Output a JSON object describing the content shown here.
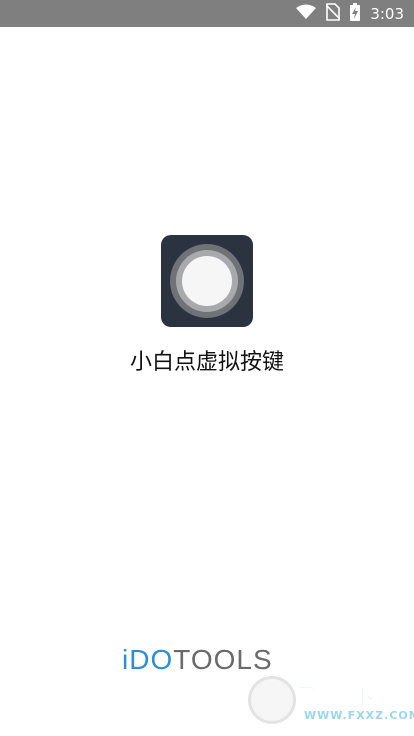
{
  "status_bar": {
    "time": "3:03",
    "icons": [
      "wifi-icon",
      "no-sim-icon",
      "battery-charging-icon"
    ],
    "background_color": "#7f7f7f"
  },
  "app": {
    "name": "小白点虚拟按键",
    "icon_colors": {
      "background": "#2c3340",
      "outer_ring": "#6f7277",
      "middle_ring": "#a7a9ad",
      "center": "#f6f6f6"
    }
  },
  "brand": {
    "part1": "iDO",
    "part2": "TOOLS",
    "color_primary": "#2b8ed6",
    "color_secondary": "#6a6a6a"
  },
  "watermark": {
    "text": "飞翔下载",
    "url": "WWW.FXXZ.COM"
  }
}
